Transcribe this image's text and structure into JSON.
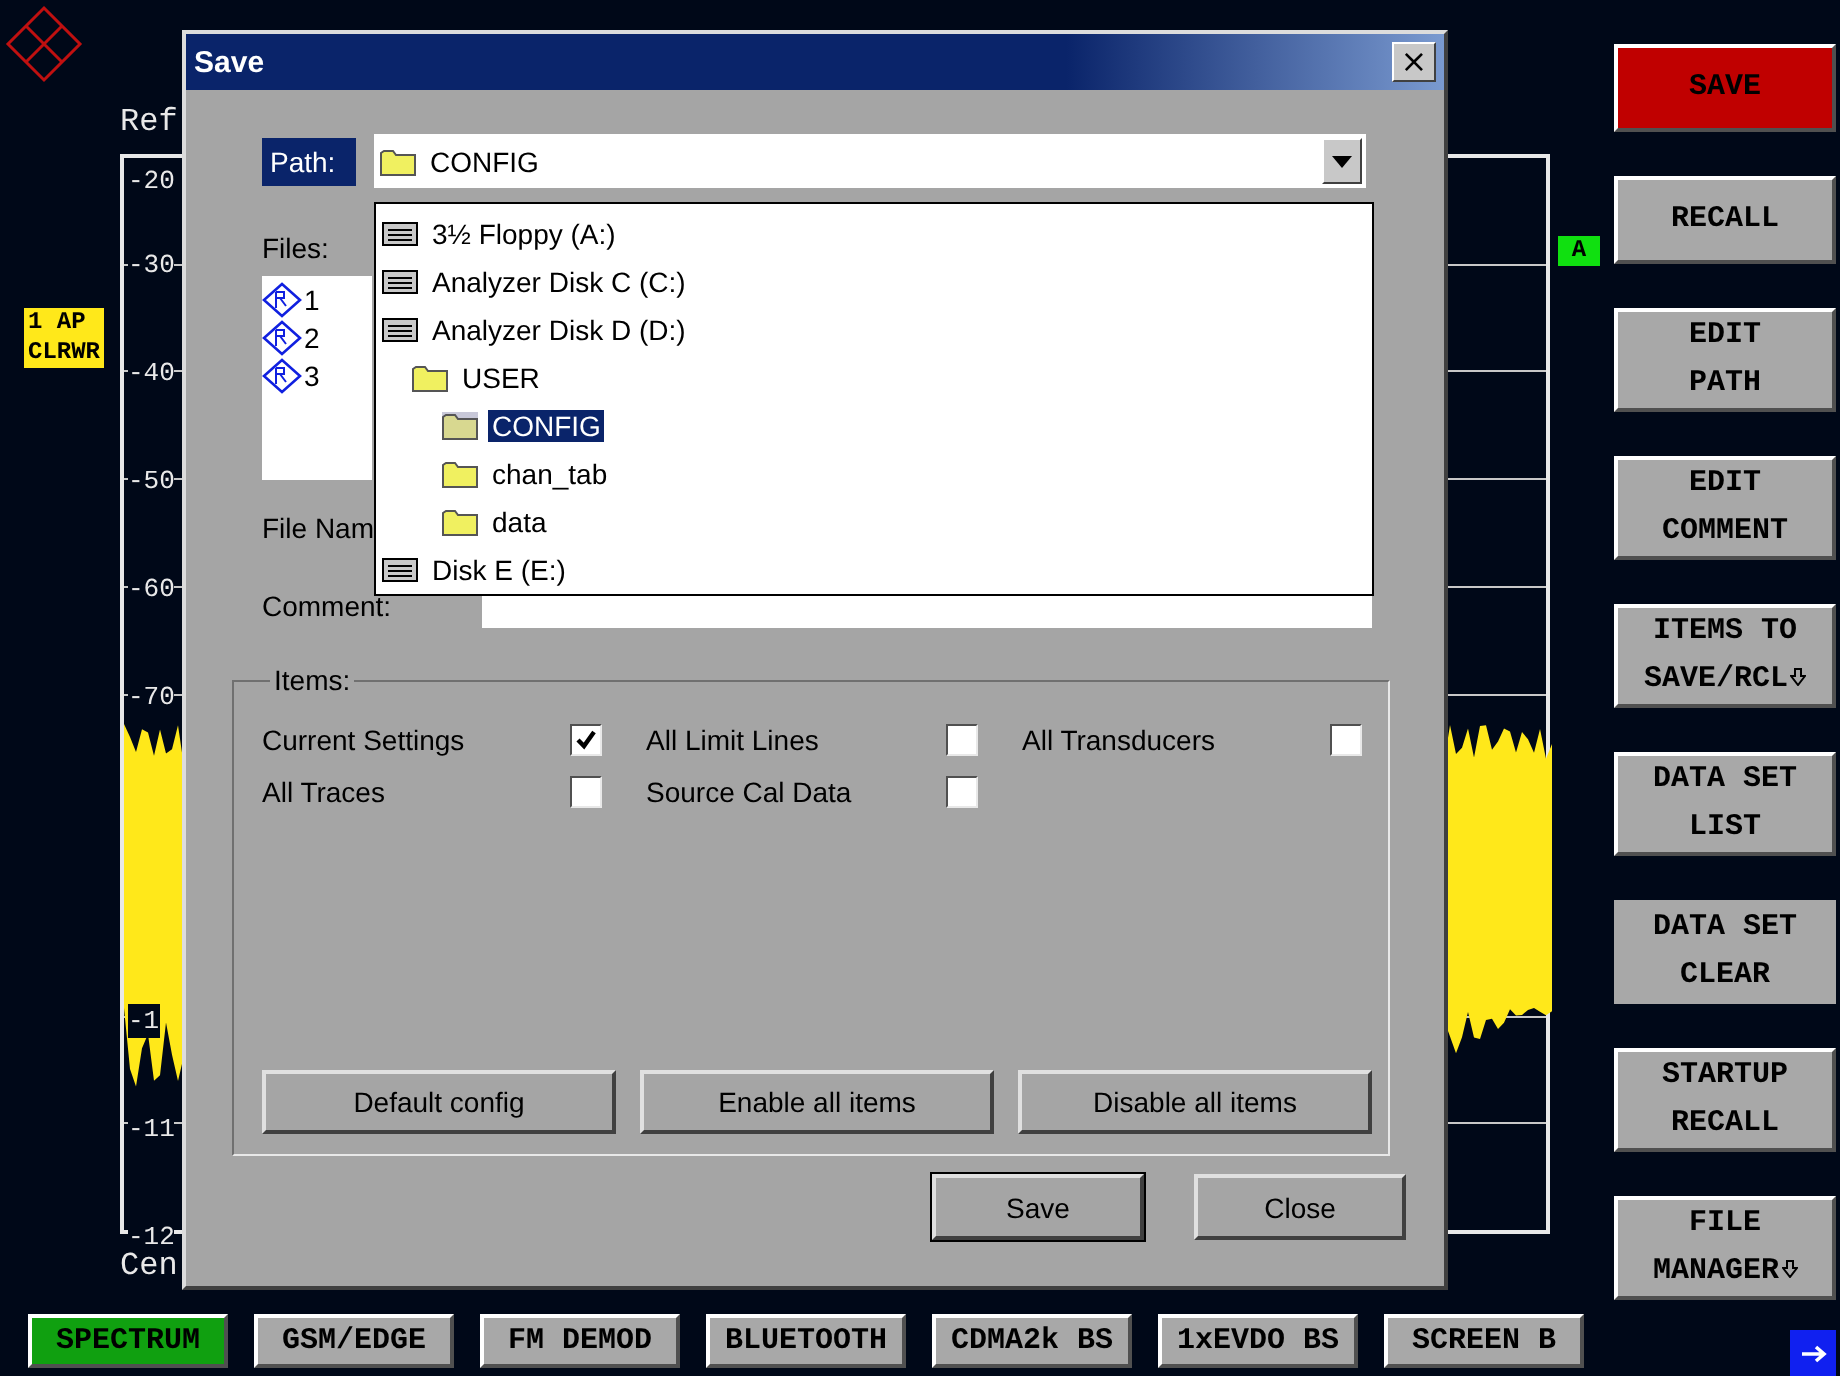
{
  "display": {
    "ref_label": "Ref",
    "center_label": "Cen",
    "scale_labels": [
      "-20",
      "-30",
      "-40",
      "-50",
      "-60",
      "-70",
      "-1",
      "-11",
      "-12"
    ],
    "trace_labels": [
      "1 AP",
      "CLRWR"
    ],
    "marker": "A"
  },
  "dialog": {
    "title": "Save",
    "close": "×",
    "path": {
      "label": "Path:",
      "value": "CONFIG"
    },
    "files": {
      "label": "Files:",
      "items": [
        {
          "name": "1"
        },
        {
          "name": "2"
        },
        {
          "name": "3"
        }
      ]
    },
    "file_name": {
      "label": "File Nam"
    },
    "comment": {
      "label": "Comment:"
    },
    "path_list": [
      {
        "label": "3½ Floppy (A:)",
        "kind": "drive",
        "selected": false
      },
      {
        "label": "Analyzer Disk C (C:)",
        "kind": "drive",
        "selected": false
      },
      {
        "label": "Analyzer Disk D (D:)",
        "kind": "drive",
        "selected": false,
        "children": [
          {
            "label": "USER",
            "kind": "folder",
            "selected": false,
            "children": [
              {
                "label": "CONFIG",
                "kind": "folder",
                "selected": true
              },
              {
                "label": "chan_tab",
                "kind": "folder",
                "selected": false
              },
              {
                "label": "data",
                "kind": "folder",
                "selected": false
              }
            ]
          }
        ]
      },
      {
        "label": "Disk E (E:)",
        "kind": "drive",
        "selected": false
      }
    ],
    "items": {
      "label": "Items:",
      "checkboxes": [
        {
          "label": "Current Settings",
          "checked": true
        },
        {
          "label": "All Limit Lines",
          "checked": false
        },
        {
          "label": "All Transducers",
          "checked": false
        },
        {
          "label": "All Traces",
          "checked": false
        },
        {
          "label": "Source Cal Data",
          "checked": false
        }
      ],
      "buttons": [
        "Default config",
        "Enable all items",
        "Disable all items"
      ]
    },
    "buttons": [
      {
        "label": "Save",
        "default": true
      },
      {
        "label": "Close",
        "default": false
      }
    ]
  },
  "softkeys": [
    {
      "label": "SAVE",
      "selected": true,
      "disabled": false
    },
    {
      "label": "RECALL",
      "selected": false,
      "disabled": false
    },
    {
      "label": "EDIT\nPATH",
      "selected": false,
      "disabled": false
    },
    {
      "label": "EDIT\nCOMMENT",
      "selected": false,
      "disabled": false
    },
    {
      "label": "ITEMS TO\nSAVE/RCL",
      "selected": false,
      "disabled": false,
      "submenu": true
    },
    {
      "label": "DATA SET\nLIST",
      "selected": false,
      "disabled": false
    },
    {
      "label": "DATA SET\nCLEAR",
      "selected": false,
      "disabled": true
    },
    {
      "label": "STARTUP\nRECALL",
      "selected": false,
      "disabled": false
    },
    {
      "label": "FILE\nMANAGER",
      "selected": false,
      "disabled": false,
      "submenu": true
    }
  ],
  "mode_tabs": [
    {
      "label": "SPECTRUM",
      "selected": true
    },
    {
      "label": "GSM/EDGE",
      "selected": false
    },
    {
      "label": "FM DEMOD",
      "selected": false
    },
    {
      "label": "BLUETOOTH",
      "selected": false
    },
    {
      "label": "CDMA2k BS",
      "selected": false
    },
    {
      "label": "1xEVDO BS",
      "selected": false
    },
    {
      "label": "SCREEN B",
      "selected": false
    }
  ]
}
